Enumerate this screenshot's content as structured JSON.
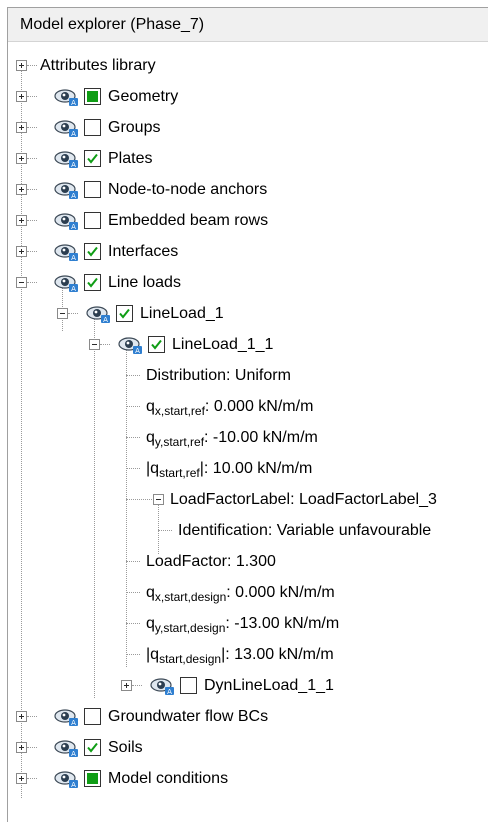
{
  "panel": {
    "title": "Model explorer (Phase_7)"
  },
  "items": {
    "attributes_library": "Attributes library",
    "geometry": "Geometry",
    "groups": "Groups",
    "plates": "Plates",
    "node_anchors": "Node-to-node anchors",
    "embedded_beams": "Embedded beam rows",
    "interfaces": "Interfaces",
    "line_loads": "Line loads",
    "lineload_1": "LineLoad_1",
    "lineload_1_1": "LineLoad_1_1",
    "distribution": "Distribution: Uniform",
    "qx_start_ref": {
      "base": "q",
      "sub": "x,start,ref",
      "value": ": 0.000 kN/m/m"
    },
    "qy_start_ref": {
      "base": "q",
      "sub": "y,start,ref",
      "value": ": -10.00 kN/m/m"
    },
    "q_start_ref_abs": {
      "open": "|q",
      "sub": "start,ref",
      "value": "|: 10.00 kN/m/m"
    },
    "load_factor_label": "LoadFactorLabel: LoadFactorLabel_3",
    "identification": "Identification: Variable unfavourable",
    "load_factor": "LoadFactor: 1.300",
    "qx_start_design": {
      "base": "q",
      "sub": "x,start,design",
      "value": ": 0.000 kN/m/m"
    },
    "qy_start_design": {
      "base": "q",
      "sub": "y,start,design",
      "value": ": -13.00 kN/m/m"
    },
    "q_start_design_abs": {
      "open": "|q",
      "sub": "start,design",
      "value": "|: 13.00 kN/m/m"
    },
    "dyn_lineload": "DynLineLoad_1_1",
    "groundwater": "Groundwater flow BCs",
    "soils": "Soils",
    "model_conditions": "Model conditions"
  },
  "icons": {
    "visibility": "eye-icon",
    "expand": "plus-box-icon",
    "collapse": "minus-box-icon"
  },
  "colors": {
    "check_fill": "#0f9d15",
    "check_mark": "#0f9d15",
    "eye_blue": "#2f7fd0"
  }
}
